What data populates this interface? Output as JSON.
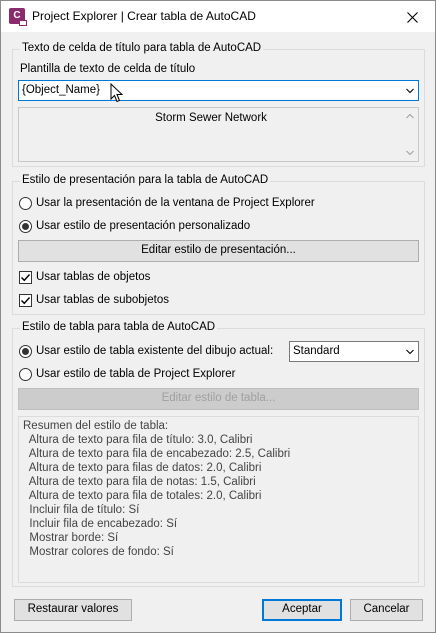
{
  "window": {
    "title": "Project Explorer | Crear tabla de AutoCAD",
    "icon_letter": "C"
  },
  "title_group": {
    "heading": "Texto de celda de título para tabla de AutoCAD",
    "template_label": "Plantilla de texto de celda de título",
    "template_value": "{Object_Name}",
    "preview_text": "Storm Sewer Network"
  },
  "presentation_group": {
    "heading": "Estilo de presentación para la tabla de AutoCAD",
    "option_window": "Usar la presentación de la ventana de Project Explorer",
    "option_custom": "Usar estilo de presentación personalizado",
    "edit_button": "Editar estilo de presentación...",
    "check_objects": "Usar tablas de objetos",
    "check_subobjects": "Usar tablas de subobjetos"
  },
  "table_style_group": {
    "heading": "Estilo de tabla para tabla de AutoCAD",
    "option_existing": "Usar estilo de tabla existente del dibujo actual:",
    "existing_value": "Standard",
    "option_explorer": "Usar estilo de tabla de Project Explorer",
    "edit_button": "Editar estilo de tabla...",
    "summary": [
      "Resumen del estilo de tabla:",
      "  Altura de texto para fila de título: 3.0, Calibri",
      "  Altura de texto para fila de encabezado: 2.5, Calibri",
      "  Altura de texto para filas de datos: 2.0, Calibri",
      "  Altura de texto para fila de notas: 1.5, Calibri",
      "  Altura de texto para fila de totales: 2.0, Calibri",
      "  Incluir fila de título: Sí",
      "  Incluir fila de encabezado: Sí",
      "  Mostrar borde: Sí",
      "  Mostrar colores de fondo: Sí"
    ]
  },
  "footer": {
    "reset": "Restaurar valores",
    "accept": "Aceptar",
    "cancel": "Cancelar"
  },
  "state": {
    "presentation_selected": "custom",
    "use_object_tables": true,
    "use_subobject_tables": true,
    "table_style_selected": "existing"
  },
  "colors": {
    "focus_blue": "#0078d7",
    "icon_purple": "#8a2c6b"
  }
}
